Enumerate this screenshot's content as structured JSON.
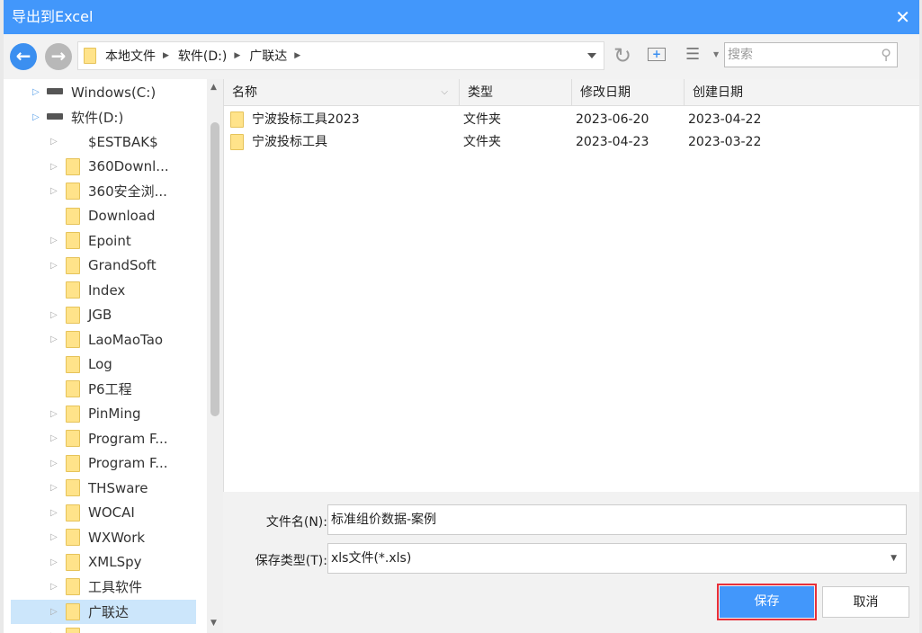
{
  "title": "导出到Excel",
  "breadcrumb": [
    "本地文件",
    "软件(D:)",
    "广联达"
  ],
  "search_placeholder": "搜索",
  "tree": [
    {
      "label": "Windows(C:)",
      "level": 1,
      "icon": "drive-windows-icon"
    },
    {
      "label": "软件(D:)",
      "level": 1,
      "icon": "drive-icon"
    },
    {
      "label": "$ESTBAK$",
      "level": 2,
      "icon": "none"
    },
    {
      "label": "360Downl...",
      "level": 2
    },
    {
      "label": "360安全浏...",
      "level": 2
    },
    {
      "label": "Download",
      "level": 2,
      "noarrow": true
    },
    {
      "label": "Epoint",
      "level": 2
    },
    {
      "label": "GrandSoft",
      "level": 2
    },
    {
      "label": "Index",
      "level": 2,
      "noarrow": true
    },
    {
      "label": "JGB",
      "level": 2
    },
    {
      "label": "LaoMaoTao",
      "level": 2
    },
    {
      "label": "Log",
      "level": 2,
      "noarrow": true
    },
    {
      "label": "P6工程",
      "level": 2,
      "noarrow": true
    },
    {
      "label": "PinMing",
      "level": 2
    },
    {
      "label": "Program F...",
      "level": 2
    },
    {
      "label": "Program F...",
      "level": 2
    },
    {
      "label": "THSware",
      "level": 2
    },
    {
      "label": "WOCAI",
      "level": 2
    },
    {
      "label": "WXWork",
      "level": 2
    },
    {
      "label": "XMLSpy",
      "level": 2
    },
    {
      "label": "工具软件",
      "level": 2
    },
    {
      "label": "广联达",
      "level": 2,
      "selected": true
    },
    {
      "label": "",
      "level": 2
    }
  ],
  "columns": [
    "名称",
    "类型",
    "修改日期",
    "创建日期"
  ],
  "files": [
    {
      "name": "宁波投标工具2023",
      "type": "文件夹",
      "modified": "2023-06-20",
      "created": "2023-04-22"
    },
    {
      "name": "宁波投标工具",
      "type": "文件夹",
      "modified": "2023-04-23",
      "created": "2023-03-22"
    }
  ],
  "filename_label": "文件名(N):",
  "filename_value": "标准组价数据-案例",
  "filetype_label": "保存类型(T):",
  "filetype_value": "xls文件(*.xls)",
  "save_label": "保存",
  "cancel_label": "取消",
  "colors": {
    "accent": "#4297fb",
    "highlight": "#e8303a",
    "selected": "#cce6fb"
  }
}
